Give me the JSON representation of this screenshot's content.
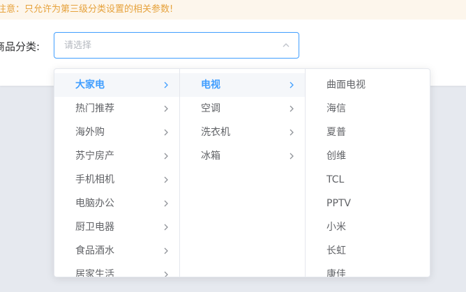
{
  "notice": {
    "text": "注意：只允许为第三级分类设置的相关参数!"
  },
  "form": {
    "label": "商品分类:",
    "placeholder": "请选择"
  },
  "cascader": {
    "level1": [
      {
        "label": "大家电",
        "active": true
      },
      {
        "label": "热门推荐"
      },
      {
        "label": "海外购"
      },
      {
        "label": "苏宁房产"
      },
      {
        "label": "手机相机"
      },
      {
        "label": "电脑办公"
      },
      {
        "label": "厨卫电器"
      },
      {
        "label": "食品酒水"
      },
      {
        "label": "居家生活"
      }
    ],
    "level2": [
      {
        "label": "电视",
        "active": true
      },
      {
        "label": "空调"
      },
      {
        "label": "洗衣机"
      },
      {
        "label": "冰箱"
      }
    ],
    "level3": [
      {
        "label": "曲面电视"
      },
      {
        "label": "海信"
      },
      {
        "label": "夏普"
      },
      {
        "label": "创维"
      },
      {
        "label": "TCL"
      },
      {
        "label": "PPTV"
      },
      {
        "label": "小米"
      },
      {
        "label": "长虹"
      },
      {
        "label": "康佳"
      }
    ]
  },
  "colors": {
    "accent": "#409eff",
    "warning": "#e6a23c",
    "warning_bg": "#fdf6ec"
  }
}
